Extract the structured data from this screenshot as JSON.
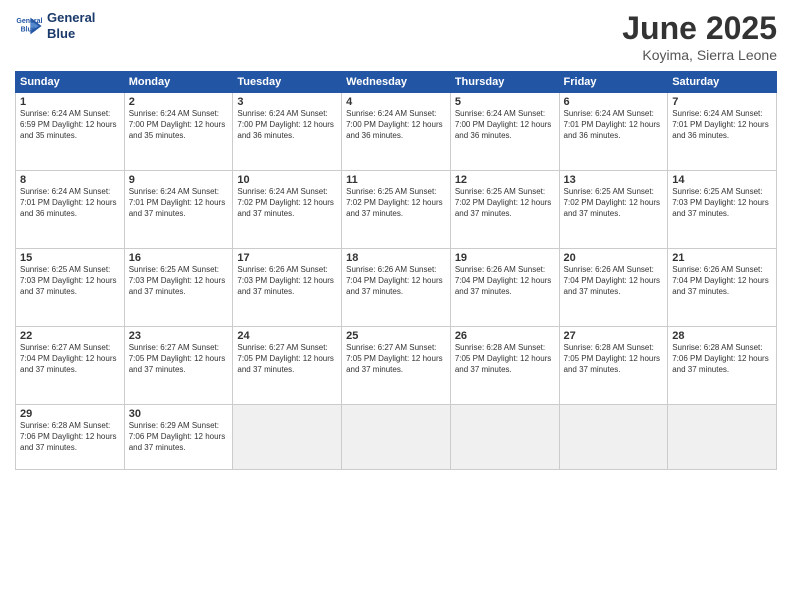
{
  "logo": {
    "line1": "General",
    "line2": "Blue"
  },
  "title": "June 2025",
  "location": "Koyima, Sierra Leone",
  "days_of_week": [
    "Sunday",
    "Monday",
    "Tuesday",
    "Wednesday",
    "Thursday",
    "Friday",
    "Saturday"
  ],
  "cells": [
    {
      "day": "",
      "info": "",
      "empty": true
    },
    {
      "day": "2",
      "info": "Sunrise: 6:24 AM\nSunset: 7:00 PM\nDaylight: 12 hours\nand 35 minutes."
    },
    {
      "day": "3",
      "info": "Sunrise: 6:24 AM\nSunset: 7:00 PM\nDaylight: 12 hours\nand 36 minutes."
    },
    {
      "day": "4",
      "info": "Sunrise: 6:24 AM\nSunset: 7:00 PM\nDaylight: 12 hours\nand 36 minutes."
    },
    {
      "day": "5",
      "info": "Sunrise: 6:24 AM\nSunset: 7:00 PM\nDaylight: 12 hours\nand 36 minutes."
    },
    {
      "day": "6",
      "info": "Sunrise: 6:24 AM\nSunset: 7:01 PM\nDaylight: 12 hours\nand 36 minutes."
    },
    {
      "day": "7",
      "info": "Sunrise: 6:24 AM\nSunset: 7:01 PM\nDaylight: 12 hours\nand 36 minutes."
    },
    {
      "day": "1",
      "info": "Sunrise: 6:24 AM\nSunset: 6:59 PM\nDaylight: 12 hours\nand 35 minutes.",
      "first": true
    },
    {
      "day": "9",
      "info": "Sunrise: 6:24 AM\nSunset: 7:01 PM\nDaylight: 12 hours\nand 37 minutes."
    },
    {
      "day": "10",
      "info": "Sunrise: 6:24 AM\nSunset: 7:02 PM\nDaylight: 12 hours\nand 37 minutes."
    },
    {
      "day": "11",
      "info": "Sunrise: 6:25 AM\nSunset: 7:02 PM\nDaylight: 12 hours\nand 37 minutes."
    },
    {
      "day": "12",
      "info": "Sunrise: 6:25 AM\nSunset: 7:02 PM\nDaylight: 12 hours\nand 37 minutes."
    },
    {
      "day": "13",
      "info": "Sunrise: 6:25 AM\nSunset: 7:02 PM\nDaylight: 12 hours\nand 37 minutes."
    },
    {
      "day": "14",
      "info": "Sunrise: 6:25 AM\nSunset: 7:03 PM\nDaylight: 12 hours\nand 37 minutes."
    },
    {
      "day": "8",
      "info": "Sunrise: 6:24 AM\nSunset: 7:01 PM\nDaylight: 12 hours\nand 36 minutes."
    },
    {
      "day": "16",
      "info": "Sunrise: 6:25 AM\nSunset: 7:03 PM\nDaylight: 12 hours\nand 37 minutes."
    },
    {
      "day": "17",
      "info": "Sunrise: 6:26 AM\nSunset: 7:03 PM\nDaylight: 12 hours\nand 37 minutes."
    },
    {
      "day": "18",
      "info": "Sunrise: 6:26 AM\nSunset: 7:04 PM\nDaylight: 12 hours\nand 37 minutes."
    },
    {
      "day": "19",
      "info": "Sunrise: 6:26 AM\nSunset: 7:04 PM\nDaylight: 12 hours\nand 37 minutes."
    },
    {
      "day": "20",
      "info": "Sunrise: 6:26 AM\nSunset: 7:04 PM\nDaylight: 12 hours\nand 37 minutes."
    },
    {
      "day": "21",
      "info": "Sunrise: 6:26 AM\nSunset: 7:04 PM\nDaylight: 12 hours\nand 37 minutes."
    },
    {
      "day": "15",
      "info": "Sunrise: 6:25 AM\nSunset: 7:03 PM\nDaylight: 12 hours\nand 37 minutes."
    },
    {
      "day": "23",
      "info": "Sunrise: 6:27 AM\nSunset: 7:05 PM\nDaylight: 12 hours\nand 37 minutes."
    },
    {
      "day": "24",
      "info": "Sunrise: 6:27 AM\nSunset: 7:05 PM\nDaylight: 12 hours\nand 37 minutes."
    },
    {
      "day": "25",
      "info": "Sunrise: 6:27 AM\nSunset: 7:05 PM\nDaylight: 12 hours\nand 37 minutes."
    },
    {
      "day": "26",
      "info": "Sunrise: 6:28 AM\nSunset: 7:05 PM\nDaylight: 12 hours\nand 37 minutes."
    },
    {
      "day": "27",
      "info": "Sunrise: 6:28 AM\nSunset: 7:05 PM\nDaylight: 12 hours\nand 37 minutes."
    },
    {
      "day": "28",
      "info": "Sunrise: 6:28 AM\nSunset: 7:06 PM\nDaylight: 12 hours\nand 37 minutes."
    },
    {
      "day": "22",
      "info": "Sunrise: 6:27 AM\nSunset: 7:04 PM\nDaylight: 12 hours\nand 37 minutes."
    },
    {
      "day": "30",
      "info": "Sunrise: 6:29 AM\nSunset: 7:06 PM\nDaylight: 12 hours\nand 37 minutes."
    },
    {
      "day": "",
      "info": "",
      "empty": true
    },
    {
      "day": "",
      "info": "",
      "empty": true
    },
    {
      "day": "",
      "info": "",
      "empty": true
    },
    {
      "day": "",
      "info": "",
      "empty": true
    },
    {
      "day": "",
      "info": "",
      "empty": true
    },
    {
      "day": "29",
      "info": "Sunrise: 6:28 AM\nSunset: 7:06 PM\nDaylight: 12 hours\nand 37 minutes."
    }
  ]
}
